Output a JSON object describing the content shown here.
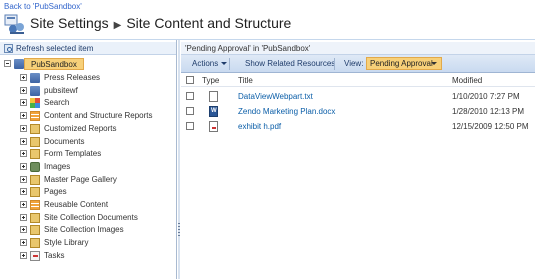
{
  "back_link": "Back to 'PubSandbox'",
  "header": {
    "title": "Site Settings",
    "subtitle": "Site Content and Structure"
  },
  "left_pane": {
    "refresh_label": "Refresh selected item",
    "root": "PubSandbox",
    "items": [
      {
        "label": "Press Releases",
        "icon": "site-icon",
        "expander": "plus"
      },
      {
        "label": "pubsitewf",
        "icon": "site-icon",
        "expander": "plus"
      },
      {
        "label": "Search",
        "icon": "search-site-icon",
        "expander": "plus"
      },
      {
        "label": "Content and Structure Reports",
        "icon": "list-icon",
        "expander": "plus"
      },
      {
        "label": "Customized Reports",
        "icon": "library-icon",
        "expander": "plus"
      },
      {
        "label": "Documents",
        "icon": "library-icon",
        "expander": "plus"
      },
      {
        "label": "Form Templates",
        "icon": "library-icon",
        "expander": "plus"
      },
      {
        "label": "Images",
        "icon": "image-library-icon",
        "expander": "plus"
      },
      {
        "label": "Master Page Gallery",
        "icon": "library-icon",
        "expander": "plus"
      },
      {
        "label": "Pages",
        "icon": "library-icon",
        "expander": "plus"
      },
      {
        "label": "Reusable Content",
        "icon": "list-icon",
        "expander": "plus"
      },
      {
        "label": "Site Collection Documents",
        "icon": "library-icon",
        "expander": "plus"
      },
      {
        "label": "Site Collection Images",
        "icon": "library-icon",
        "expander": "plus"
      },
      {
        "label": "Style Library",
        "icon": "library-icon",
        "expander": "plus"
      },
      {
        "label": "Tasks",
        "icon": "task-icon",
        "expander": "plus"
      }
    ]
  },
  "right_pane": {
    "title": "'Pending Approval' in 'PubSandbox'",
    "toolbar": {
      "actions": "Actions",
      "show_related": "Show Related Resources",
      "view_label": "View:",
      "view_value": "Pending Approval"
    },
    "columns": {
      "type": "Type",
      "title": "Title",
      "modified": "Modified"
    },
    "rows": [
      {
        "title": "DataViewWebpart.txt",
        "modified": "1/10/2010 7:27 PM",
        "icon": "text-file-icon"
      },
      {
        "title": "Zendo Marketing Plan.docx",
        "modified": "1/28/2010 12:13 PM",
        "icon": "word-file-icon"
      },
      {
        "title": "exhibit h.pdf",
        "modified": "12/15/2009 12:50 PM",
        "icon": "pdf-file-icon"
      }
    ]
  }
}
